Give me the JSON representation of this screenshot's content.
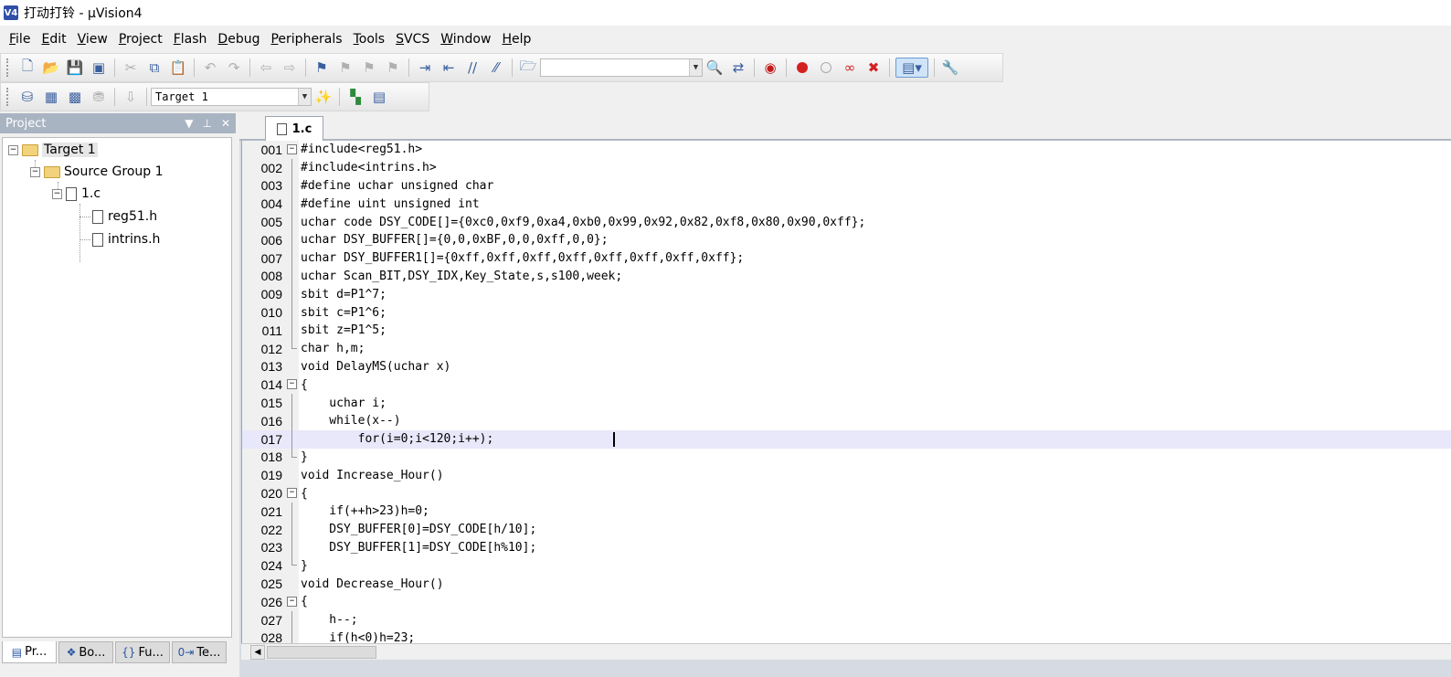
{
  "window": {
    "title": "打动打铃 - μVision4",
    "icon_label": "V4"
  },
  "menu": [
    "File",
    "Edit",
    "View",
    "Project",
    "Flash",
    "Debug",
    "Peripherals",
    "Tools",
    "SVCS",
    "Window",
    "Help"
  ],
  "toolbar2": {
    "target_select": "Target 1"
  },
  "project_panel": {
    "title": "Project",
    "tree": {
      "target": "Target 1",
      "group": "Source Group 1",
      "file": "1.c",
      "includes": [
        "reg51.h",
        "intrins.h"
      ]
    },
    "tabs": [
      "Pr...",
      "Bo...",
      "Fu...",
      "Te..."
    ]
  },
  "editor": {
    "tab_label": "1.c",
    "lines": [
      {
        "n": "001",
        "code": "#include<reg51.h>"
      },
      {
        "n": "002",
        "code": "#include<intrins.h>"
      },
      {
        "n": "003",
        "code": "#define uchar unsigned char"
      },
      {
        "n": "004",
        "code": "#define uint unsigned int"
      },
      {
        "n": "005",
        "code": "uchar code DSY_CODE[]={0xc0,0xf9,0xa4,0xb0,0x99,0x92,0x82,0xf8,0x80,0x90,0xff};"
      },
      {
        "n": "006",
        "code": "uchar DSY_BUFFER[]={0,0,0xBF,0,0,0xff,0,0};"
      },
      {
        "n": "007",
        "code": "uchar DSY_BUFFER1[]={0xff,0xff,0xff,0xff,0xff,0xff,0xff,0xff};"
      },
      {
        "n": "008",
        "code": "uchar Scan_BIT,DSY_IDX,Key_State,s,s100,week;"
      },
      {
        "n": "009",
        "code": "sbit d=P1^7;"
      },
      {
        "n": "010",
        "code": "sbit c=P1^6;"
      },
      {
        "n": "011",
        "code": "sbit z=P1^5;"
      },
      {
        "n": "012",
        "code": "char h,m;"
      },
      {
        "n": "013",
        "code": "void DelayMS(uchar x)"
      },
      {
        "n": "014",
        "code": "{"
      },
      {
        "n": "015",
        "code": "    uchar i;"
      },
      {
        "n": "016",
        "code": "    while(x--)"
      },
      {
        "n": "017",
        "code": "        for(i=0;i<120;i++);"
      },
      {
        "n": "018",
        "code": "}"
      },
      {
        "n": "019",
        "code": "void Increase_Hour()"
      },
      {
        "n": "020",
        "code": "{"
      },
      {
        "n": "021",
        "code": "    if(++h>23)h=0;"
      },
      {
        "n": "022",
        "code": "    DSY_BUFFER[0]=DSY_CODE[h/10];"
      },
      {
        "n": "023",
        "code": "    DSY_BUFFER[1]=DSY_CODE[h%10];"
      },
      {
        "n": "024",
        "code": "}"
      },
      {
        "n": "025",
        "code": "void Decrease_Hour()"
      },
      {
        "n": "026",
        "code": "{"
      },
      {
        "n": "027",
        "code": "    h--;"
      },
      {
        "n": "028",
        "code": "    if(h<0)h=23;"
      }
    ]
  }
}
